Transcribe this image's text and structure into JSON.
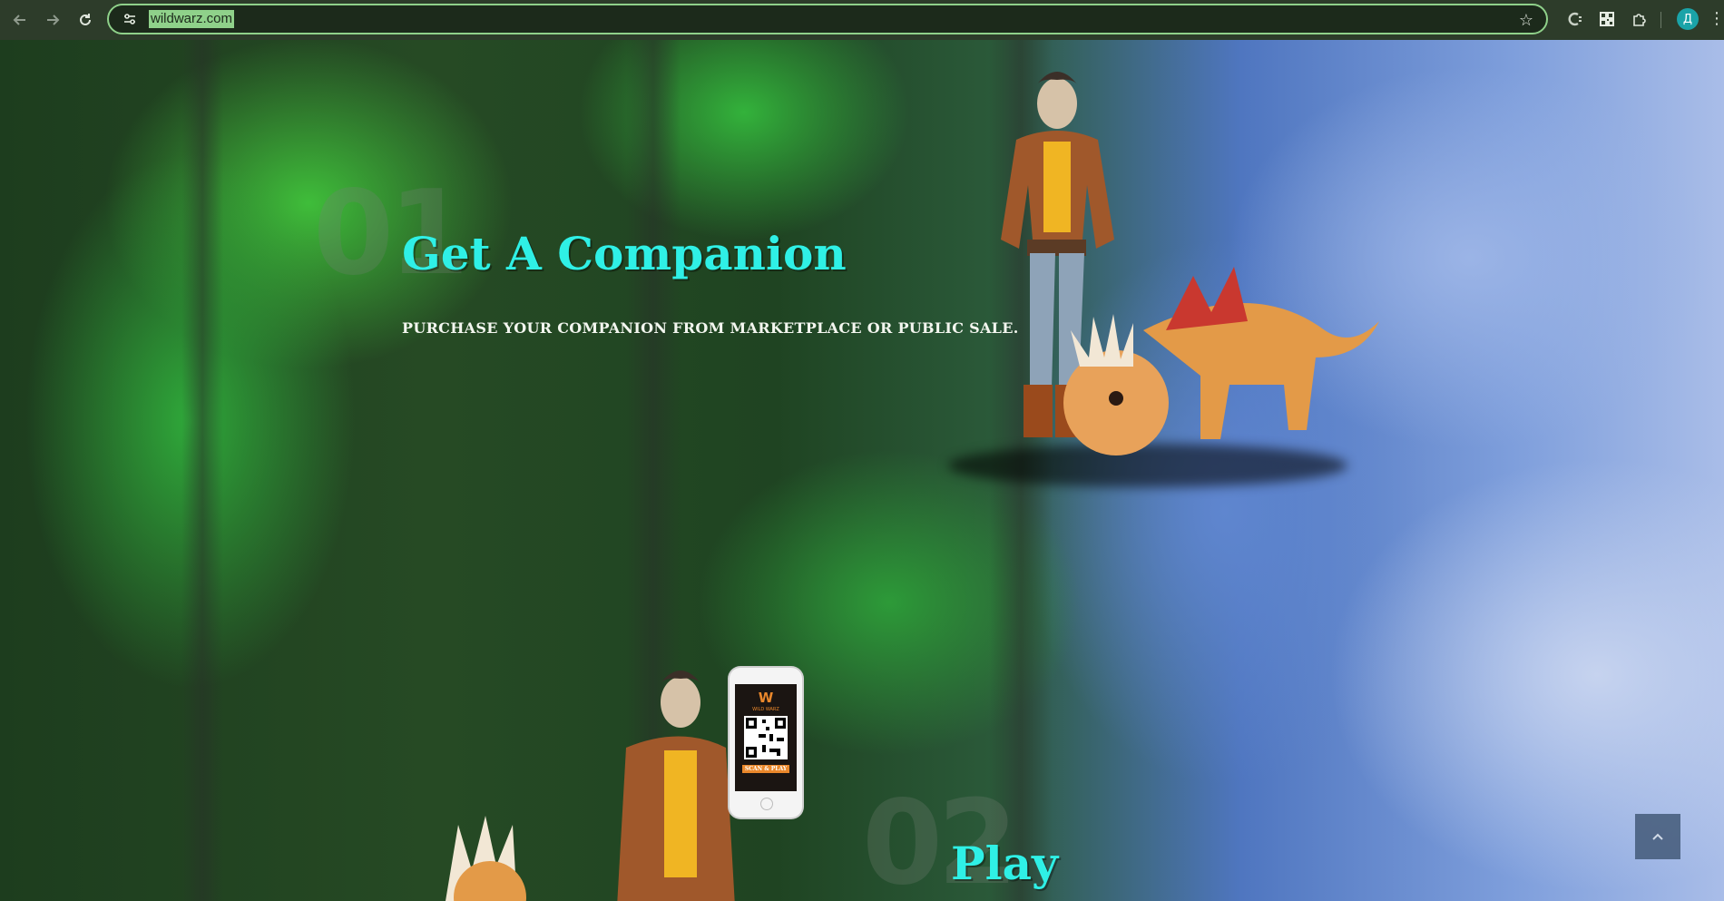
{
  "browser": {
    "url": "wildwarz.com",
    "icons": {
      "back": "back-arrow-icon",
      "forward": "forward-arrow-icon",
      "reload": "reload-icon",
      "site_info": "site-settings-icon",
      "bookmark": "star-icon",
      "extension_1": "extension-c-icon",
      "extension_2": "qr-code-icon",
      "extensions": "puzzle-icon",
      "menu": "kebab-menu-icon"
    },
    "profile_initial": "Д"
  },
  "steps": [
    {
      "number": "01",
      "title": "Get A Companion",
      "description": "PURCHASE YOUR COMPANION FROM MARKETPLACE OR PUBLIC SALE."
    },
    {
      "number": "02",
      "title": "Play"
    }
  ],
  "phone": {
    "logo_text": "WILD WARZ",
    "cta_text": "SCAN & PLAY"
  },
  "scroll_to_top": {
    "icon": "chevron-up-icon"
  },
  "colors": {
    "accent_title": "#2ff0e6",
    "omnibox_border": "#8fd18a",
    "scroll_button": "#4b6282"
  }
}
